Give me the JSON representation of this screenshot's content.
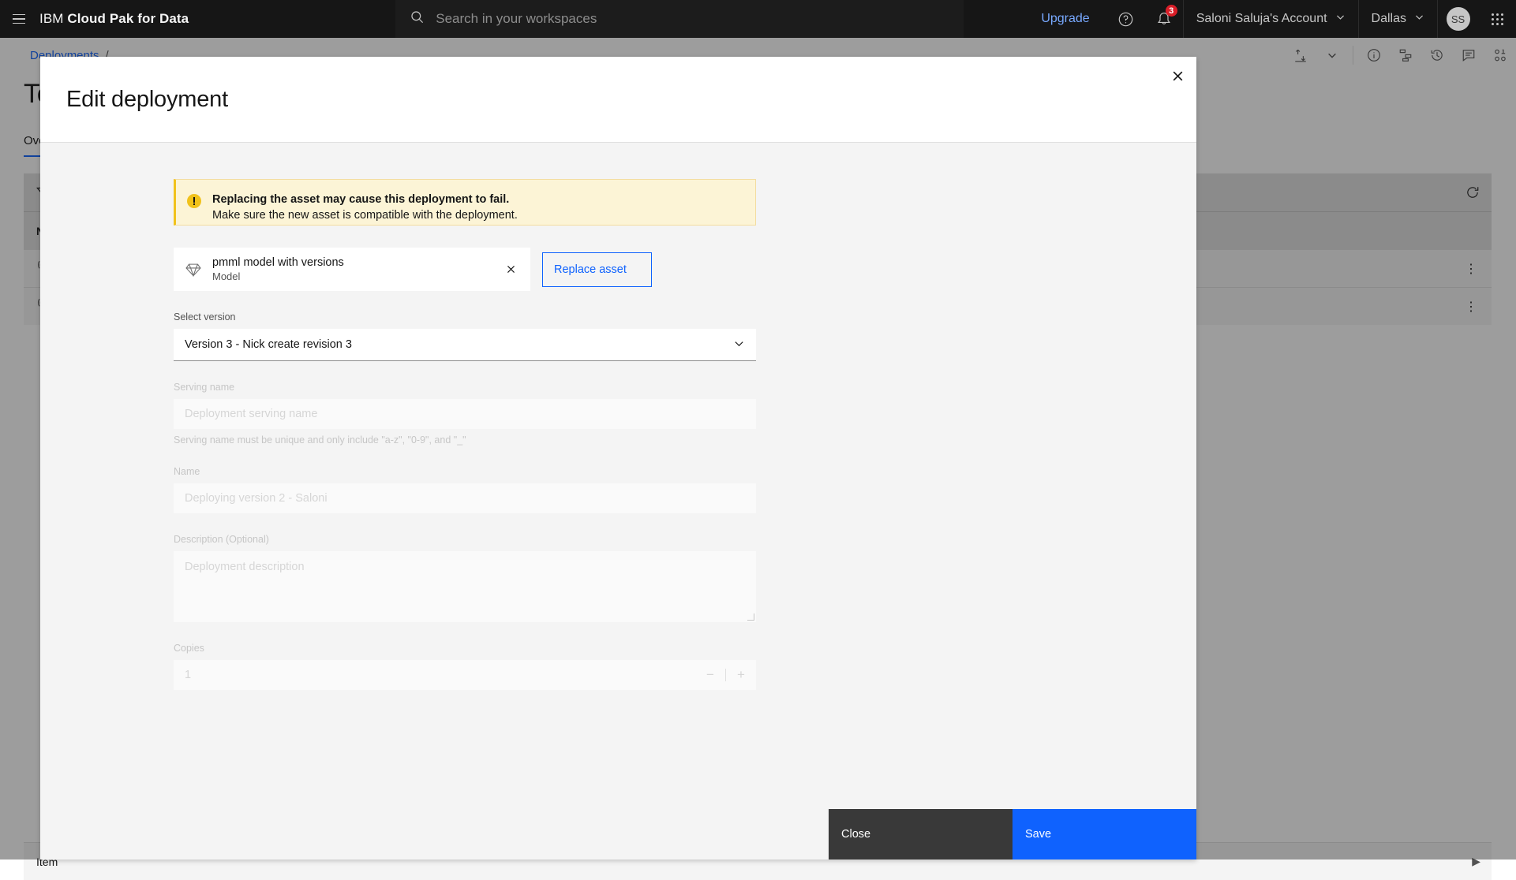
{
  "topbar": {
    "menu_icon": "hamburger-menu-icon",
    "brand_prefix": "IBM",
    "brand_name": "Cloud Pak for Data",
    "search_icon": "search-icon",
    "search_placeholder": "Search in your workspaces",
    "search_value": "",
    "upgrade_label": "Upgrade",
    "help_icon": "help-circle-icon",
    "notifications_icon": "bell-icon",
    "notification_count": "3",
    "account_label": "Saloni Saluja's Account",
    "account_chevron": "chevron-down-icon",
    "region_label": "Dallas",
    "region_chevron": "chevron-down-icon",
    "avatar_initials": "SS",
    "app_switcher_icon": "app-grid-icon"
  },
  "breadcrumb": {
    "root_label": "Deployments",
    "separator": "/",
    "tools": [
      {
        "icon": "upload-download-icon"
      },
      {
        "icon": "chevron-down-icon"
      },
      {
        "icon": "information-icon"
      },
      {
        "icon": "hierarchy-icon"
      },
      {
        "icon": "history-icon"
      },
      {
        "icon": "comment-icon"
      },
      {
        "icon": "code-binary-icon"
      }
    ]
  },
  "page": {
    "title": "Te",
    "tabs": [
      {
        "label": "Ove"
      }
    ],
    "filter_icon": "filter-icon",
    "refresh_icon": "refresh-icon",
    "table": {
      "columns": [
        "Nam"
      ],
      "rows": [
        {
          "icon": "deployment-broadcast-icon",
          "overflow": "overflow-menu-icon"
        },
        {
          "icon": "deployment-broadcast-icon",
          "overflow": "overflow-menu-icon"
        }
      ],
      "footer_label": "Item"
    }
  },
  "modal": {
    "title": "Edit deployment",
    "close_icon": "close-icon",
    "notification": {
      "icon": "warning-filled-icon",
      "title": "Replacing the asset may cause this deployment to fail.",
      "subtitle": "Make sure the new asset is compatible with the deployment."
    },
    "asset": {
      "icon": "gem-model-icon",
      "name": "pmml model with versions",
      "type": "Model",
      "remove_icon": "close-icon",
      "replace_label": "Replace asset"
    },
    "version": {
      "label": "Select version",
      "value": "Version 3 - Nick create revision 3",
      "chevron": "chevron-down-icon"
    },
    "serving_name": {
      "label": "Serving name",
      "value": "",
      "placeholder": "Deployment serving name",
      "helper": "Serving name must be unique and only include \"a-z\", \"0-9\", and \"_\""
    },
    "name": {
      "label": "Name",
      "value": "",
      "placeholder": "Deploying version 2 - Saloni"
    },
    "description": {
      "label": "Description (Optional)",
      "value": "",
      "placeholder": "Deployment description"
    },
    "copies": {
      "label": "Copies",
      "value": "1",
      "decrement": "−",
      "increment": "+"
    },
    "footer": {
      "close_label": "Close",
      "save_label": "Save"
    }
  },
  "colors": {
    "brand_blue": "#0f62fe",
    "link_blue": "#78a9ff",
    "warning_yellow": "#f1c21b",
    "warning_bg": "#fcf4d6",
    "danger_red": "#da1e28",
    "dark_gray": "#393939",
    "header_black": "#161616"
  }
}
